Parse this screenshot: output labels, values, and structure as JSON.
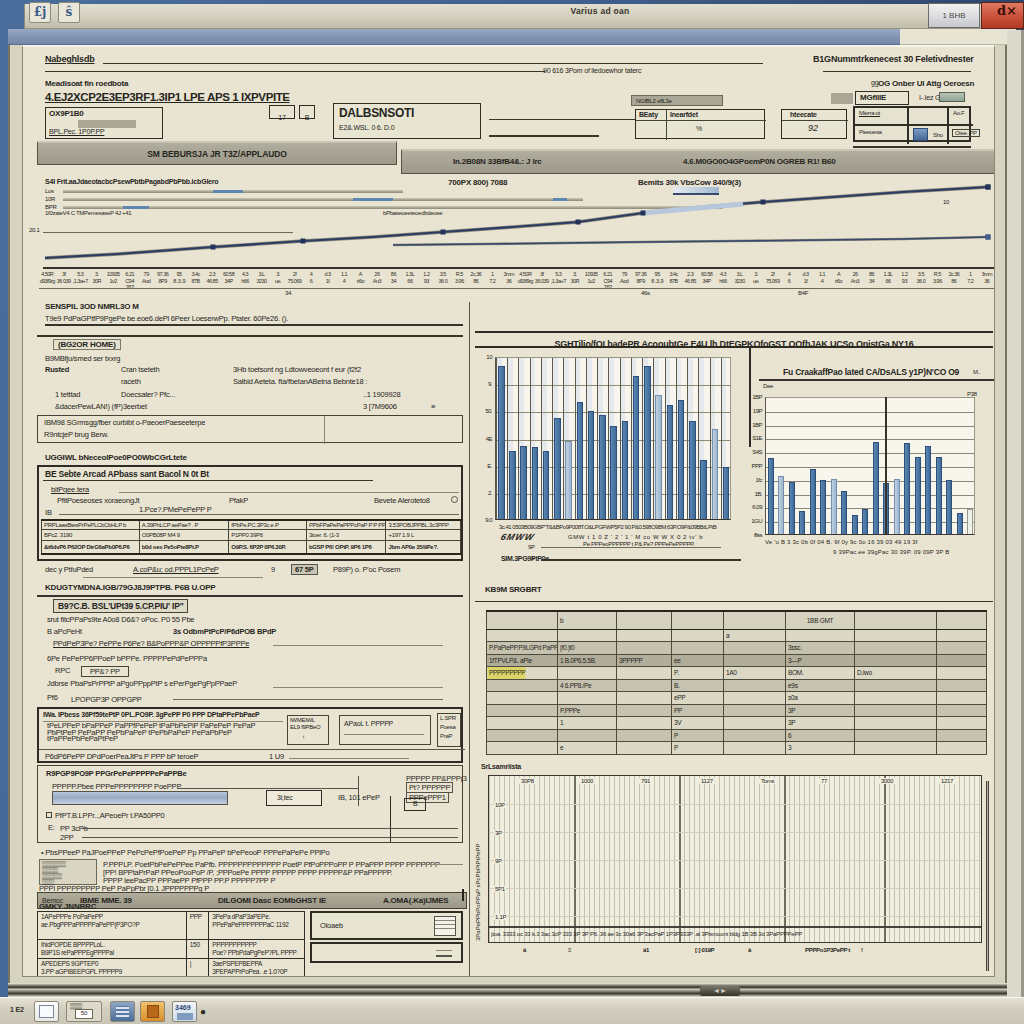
{
  "window": {
    "title": "Varius ad oan",
    "restore_button": "1 BHB",
    "close_button": "d×",
    "app_icon_1": "£j",
    "app_icon_2": "ŝ"
  },
  "header": {
    "left_label": "Nabeghlsdb",
    "right_label": "B1GNummtrkenecest 30 Feletivdnester",
    "center_note": "90 616 3Pom of liedoewhor taterc",
    "sub_label": "Meadisoat fin roedbota",
    "doc_title": "4.EJ2XCP2E3EP3RF1.3IP1 LPE APS 1 IXPVPITE",
    "field1_label": "OX9P1B0",
    "field1_value": "BPL.Pec. 1P0P.PP",
    "tick1": "17",
    "tick2": "B",
    "field2_label": "DALBSNSOTI",
    "field2_value": "E2&.WSL. 0 6. D.0",
    "dd_label": "NGfBL2 effL3e",
    "grid1_h1": "BEaty",
    "grid1_h2": "Inearfdet",
    "grid1_v": "%",
    "grid2_h": "hteecate",
    "grid2_v": "92",
    "right_top": "OG Onber UI  Attg Oeroesn",
    "right_gg": "gg",
    "right_chip": "MGfllIE",
    "right_small": "I-.Iez Gezet 9",
    "rg_r1c1": "Mierra ot",
    "rg_r1c3": "Ao.F",
    "rg_r2c1": "Pieeoesa",
    "rg_r2c3": "Oiee. PP",
    "rg_sho": "Sho"
  },
  "tabs": {
    "tab1": "SM BEBURSJA JR T3Z/APPLAUDO",
    "tab2": "In.2B08N 33BfB4&.: J lrc",
    "tab3": "4.6.M0GO0O4GPoemP0N OGREB R1!   B60"
  },
  "line_chart": {
    "title_left": "700PX 800)  7088",
    "title_right": "Bemits 30k VbsCow  840/9(3)",
    "legend_caption": "S4I Frit.aaJdaeotacbcPsewPbtbPagabdPbPbb.icbGlero",
    "legend_rows": [
      "Los",
      "10R",
      "BPR"
    ],
    "legend_note1": "1f0zateV4 C TMPemesaseP  4J    +41",
    "legend_note2": "bPbaseoeeteoedbdeoee",
    "ytick": "20.1",
    "callout": "10",
    "series_a": [
      [
        2,
        9
      ],
      [
        75,
        13
      ],
      [
        170,
        20
      ],
      [
        260,
        26
      ],
      [
        330,
        30
      ],
      [
        400,
        35
      ],
      [
        470,
        40
      ],
      [
        535,
        45
      ],
      [
        600,
        54
      ],
      [
        660,
        60
      ],
      [
        720,
        65
      ],
      [
        790,
        70
      ],
      [
        860,
        75
      ],
      [
        945,
        80
      ]
    ],
    "series_b": [
      [
        350,
        22
      ],
      [
        440,
        23
      ],
      [
        520,
        24
      ],
      [
        600,
        25
      ],
      [
        690,
        26
      ],
      [
        780,
        27
      ],
      [
        860,
        28
      ],
      [
        945,
        30
      ]
    ],
    "markers_a": [
      2,
      3,
      5,
      7,
      8,
      10,
      13
    ],
    "markers_b": [
      7
    ]
  },
  "strip": {
    "row1": [
      "4.50R",
      "3f",
      "5.3",
      "3.",
      "10935",
      "6.21",
      "79",
      "97.36",
      "95",
      "3.4c",
      "2.3",
      "60.58",
      "4.3",
      "3.L",
      "3.",
      "2f",
      "4",
      "d.3",
      "1.1",
      "A",
      "26",
      "86",
      "1.3L",
      "1.2",
      "3.5",
      "R.5",
      "2c.36",
      "1",
      "3mm"
    ],
    "row2": [
      "d93f9rg",
      "36 039",
      ",1.3a+7",
      "30R",
      "1v2",
      "C94 76?",
      "Aod",
      "8P9",
      "8 .3..9",
      "87B",
      "46 85",
      "34P",
      "h66",
      "3230",
      "ue.",
      "75.069",
      "6",
      "1f",
      "4",
      "ri6o",
      "An3",
      "34",
      "66",
      "93",
      "36 0",
      "3.96",
      "86",
      "7.2",
      "36"
    ],
    "label1": "34.",
    "label2": "46s",
    "label3": "B4F"
  },
  "left": {
    "h1": "SENSPIL 3OD NMRL3O M",
    "p1": "T9e9 PdPaGPtfP9PgePe be.eoe6.dePl 6Peer LoeserwPp. Ptater. 60Pe26. ().",
    "tag": "(BG2OR HOME)",
    "s1": "B9MBfju/smed ser txxrg",
    "r1a": "Rusted",
    "r1b": "Cran tseteth",
    "r1c": "3Hb toetsont ng Ldtowveoeont f eur (f2f2",
    "r2b": "raceth",
    "r2c": "Salbid Aeteta. fta/fbetanABetna Bebnte18 :",
    "r3a": "1 tetttad",
    "r3b": "Doecsater? Pfc...",
    "r3c": "..1 1909928",
    "r4a": "&dacerPewLAN!) (fP)3eerbet",
    "r4b": "3 [7M9606",
    "r4c": "≡",
    "box1_l1": "IBM98 SGrmsgg/fber curbibt o-PaeoerPaeseeterpe",
    "box1_l2": "R9ntcjeP brug Berw.",
    "h2": "UGGIWL bNeceoIPoe0PO0WbCGrLtete",
    "bx_title": "BE Sebte Arcad APbass sant Bacol N 0t Bt",
    "bx_lab": "bitPgee.tera",
    "bx_r1": "PfitPoeseoses xoraeongJt",
    "bx_r2": "PfakP",
    "bx_r3": "Bevete Aleroteto8",
    "bx_ib": "IB",
    "bx_note": "1.Pce?.PMePePePP  P",
    "tbl_h": [
      "PRPLaasBtesPrPePLCbCbHLP b",
      "A.39PhLCP aePae?  . P",
      "fPbPe.PC.3P3c.e P",
      "PPbFPaPePaPPPcPaP P P PPePP",
      "3.53POBJPPBL.3c3PPP"
    ],
    "tbl_r1": [
      "BPc2.        3190",
      "O0PB08P      M4 9",
      "P1PP0        39P6",
      "3toer.    6. (1-3",
      "+197 1.9 L"
    ],
    "tbl_r2": [
      "&t6dvP6 P62OP DtrG6aPb0P6.P6",
      "b0d oes Pe5oPte8Pt.P",
      "O9P.S. 6P2P 0P6.30P.",
      "bGSP P6! OPtP. 9P6 1P6",
      "Jbm AP0e 35/9Pe?."
    ],
    "under1": "dec y PtfuPded",
    "under2": "A.coP&u; od.PPPL1PcPeP",
    "under3": "9",
    "under4": "67 5P",
    "under5": "P89P) o. P'oc Posem",
    "h3": "KDUGTYMDNA.IGB/79GJ8J9PTPB. P6B U.OPP",
    "s3_t1": "B9?C.B. BSL'UPt39 5.CP.PIU' IP\"",
    "s3_l1": "srut fitcPPaPs9te A0o8 D6&? oPoc. P0 55 Pbe",
    "s3_l2": "B aPcPeHt",
    "s3_l3": "3s OdbmPtPcP/P6dPOB BPdP",
    "s3_l4": "PPdPeP3Pe? PePPe P6Pe? B&PoPPP&P OPPPPPfP3PPPe",
    "s3_l5": "6Pe PePePP6PPoeP bPPPe. PPPPPePdPePPPa",
    "s3_l6": "RPC",
    "s3_l6b": "PP&? PP",
    "s3_l7": "Jdbrse PbaPsPrPPtP aPgoPPppPtP s ePerPgePgPpPPaeP",
    "s3_l8": "Pf6",
    "s3_l8b": "LPOPGP3P OPPGPP",
    "cx_t1": "IWa. IPbess 36Pf59tePtP 0PL.PO9P. 3gPePP P0 PPP DPtaPPePbPaeP",
    "cx_dense": "tPeLPPeP bPaPPeP PaPPfPePeP tPaPbPePiP PaPePeP PePaP PbPtPeP PePaPP PePbPaPeP tPePbPaPeP PePaPbPeP tPaPPePbPePaPtPeP",
    "cx_b1a": "IWMEIWL",
    "cx_b1b": "EL9 f9PBeO",
    "cx_b2": "APaoL t. PPPPP",
    "cx_b3a": "L.SPR",
    "cx_b3b": "Poesa",
    "cx_b3c": "PraP",
    "cx_l2": "P6dP6PePP DPdPoerPeaJtPs P PPP bP teroeP",
    "cx_l2b": "1 U9",
    "c2_t1": "R9PGP9PO9P PPGrPePePPPPPePaPPBe",
    "c2_l1": "PPPPP.Pbee PPPePPPPPPPP PoePPP",
    "c2_r1": "PPPPP PP&PPP(3",
    "c2_r2": "Pt? PPPPPP",
    "c2_r3": "PPPePPP1",
    "c2_bx1": "3i,tec",
    "c2_bx2": "IB, 101 ePeP",
    "c2_bx3": "B",
    "c2_l3": "PfPT.B.LPPr..,APeoePr t.PA50PP0",
    "c2_e1": "E:",
    "c2_e2": "PP 3cPb",
    "c2_e3": "2PP",
    "bullet": "• PbsPPeeP PaJPoePPeP PePcPePfPoePeP Pp PPaPeP bPePeooP PPPePaPePe PPlPo",
    "n1": "P.PPPLP. PoetPbPePePPee PaPfb.  PPPPPPPPPPPPP PoetP PfPoPPPoPP P PPaPPP PPPP PPPPPPP",
    "n2": "[PP! BPPtaPrPaP PPeoPooPoP /P, ;PPPoePe PPPP PPPPP PPPP PPPPP&P PPaPPPPP.",
    "n3": "PPPP IeePacPP PPPaePP PfPPP PP.P PPPPP7PP P",
    "n4": "PPPl PPPPPPPPP PeP PaPpPbr [0.1 JPPPPPPPg P",
    "band1": "Bemoc",
    "band2": "IBME MME. 39",
    "band3": "DILGOMI Dasc EOMbGHST IE",
    "band4": "A.OMA(.Ka)IJMES",
    "bl_title": "GMKY JNNRRC",
    "bl_r1c1a": "1APePPPe PoPaPePP",
    "bl_r1c1b": "ae.PbgPPPaPPPPPaPePP(P3PO?P",
    "bl_r1c2": "PPP",
    "bl_r1c3a": "3PePa dPaP3aPEPe.",
    "bl_r1c3b": "PPePaPePPPPPPPaC",
    "bl_r1n": "1192",
    "bl_r1c4": "Oloaeb",
    "bl_r2c1a": "IhidPOPDE BPPPPLoL.",
    "bl_r2c1b": "B9P1S rePaPPPEgPPPPal",
    "bl_r2c2": "150",
    "bl_r2c3a": "PPPPPPPPPPP",
    "bl_r2c3b": "Poe? PPbPdaPgPeP?PL",
    "bl_r2n": "PPPP",
    "bl_r3c1a": "APEDEPS 9GPTEP0",
    "bl_r3c1b": "3.PP aGPIBEEPGPL PPPPP9",
    "bl_r3c2": "|",
    "bl_r3c3a": "3aePSPEPBEPPA",
    "bl_r3c3b": "3PEPAPPrPoPea. .e  1.0?0P"
  },
  "right": {
    "panel_title": "SGHTilio/fOI badePR AcooubtGe E4U lh DtEGPKOfoGST OOfhJAK UCSo OnistGa NY16",
    "chart1": {
      "type": "bar",
      "ylabels": [
        "10",
        "9.",
        "50.",
        "4E",
        "E.",
        "2.",
        "9.0"
      ],
      "values": [
        94,
        42,
        45,
        44,
        42,
        62,
        48,
        72,
        66,
        64,
        57,
        60,
        88,
        94,
        76,
        70,
        73,
        60,
        36,
        55,
        32
      ],
      "light_bars": [
        6,
        14,
        19
      ],
      "xrow1": "3c.41 0503B09GBP\"T&&BPo9P008T.O&LPGFWP5P2   90.P&0.598O9BM.63P.O9P&09BB&.PtB",
      "xrow2": "GMW  t  1  0  Z  '  2  '  1  '  M  co  W  W  X  0  2 tv'  b",
      "sig": "6MWW",
      "leg1": "9P",
      "leg1b": "Pe PPPeoPPPPPP  t  P&  Pe? PPPePePPPPP.",
      "leg2": "1",
      "foot": "SIM.3PG9PtP0e"
    },
    "chart2": {
      "type": "bar",
      "title": "Fu CraakaffPao lated CA/DsALS  y1P)N'CO O9",
      "title_tick": "M..",
      "dee": "Dee",
      "right_tick": "P38",
      "ylabels": [
        "1BP",
        "19P",
        "1BP",
        "S1E",
        "S4S",
        "PPP",
        "1fc",
        "1B.",
        "6.09",
        "1GU",
        "ffiss"
      ],
      "values": [
        55,
        42,
        38,
        17,
        47,
        39,
        40,
        31,
        14,
        18,
        67,
        37,
        40,
        66,
        56,
        64,
        56,
        39,
        15,
        18
      ],
      "light_bars": [
        1,
        6,
        12
      ],
      "ghost_bars": [
        19
      ],
      "xrow1": "Ve  'u  B  3  3c  0b  0f  04  B.  9f  0y  9c  0o  16  39  03  49  19  3f",
      "xrow2": "9  39Pac.ee 39gPac 30 39P. 09 09P   3P    B"
    },
    "summary_title": "KB9M SRGBRT",
    "table_rows": [
      {
        "style": "hdr",
        "cells": [
          "",
          "b",
          "",
          "",
          "",
          "1BB GMT",
          "",
          ""
        ]
      },
      {
        "style": "plain",
        "cells": [
          "",
          "",
          "",
          "",
          "a",
          "",
          "",
          ""
        ]
      },
      {
        "style": "mid",
        "cells": [
          "P.PaPiePP.P9LGPd PaPP",
          "|f0.)t0",
          "",
          "",
          "",
          "3ssc.",
          "",
          ""
        ]
      },
      {
        "style": "dark",
        "cells": [
          "1fTPVLP&. aPie",
          "1 B.0P6.5.5B",
          "3PPPPP",
          "ee",
          "",
          "3—P",
          "",
          ""
        ]
      },
      {
        "style": "plain",
        "cells": [
          "PPPPPPPPP",
          "",
          "",
          "P.",
          "1A0",
          "BOM.",
          "D.lwo",
          ""
        ]
      },
      {
        "style": "mid",
        "cells": [
          "",
          "4 6.PP8./Pe",
          "",
          "B.",
          "",
          "e9s",
          "",
          ""
        ]
      },
      {
        "style": "plain",
        "cells": [
          "",
          "",
          "",
          "ePP",
          "",
          "s0a",
          "",
          ""
        ]
      },
      {
        "style": "mid",
        "cells": [
          "",
          "P.PPPe",
          "",
          "PP",
          "",
          "3P",
          "",
          ""
        ]
      },
      {
        "style": "plain",
        "cells": [
          "",
          "1",
          "",
          "3V",
          "",
          "3P",
          "",
          ""
        ]
      },
      {
        "style": "mid",
        "cells": [
          "",
          "",
          "",
          "P",
          "",
          "6",
          "",
          ""
        ]
      },
      {
        "style": "plain",
        "cells": [
          "",
          "e",
          "",
          "P",
          "",
          "3",
          "",
          ""
        ]
      }
    ],
    "gantt_title": "SrLsamriista",
    "gantt": {
      "top_labels": [
        "30P8",
        "1000",
        "791",
        "1127",
        "Toms",
        "77",
        "3000",
        "1217"
      ],
      "left_labels": [
        "10P",
        "3P",
        "9P",
        "5P1",
        "1.1P"
      ],
      "side_text": "3PaPePPbPoPPaP sPcPbPtPtPePP",
      "side_text2": "1P",
      "bottom_text": "jtoa. 3333 oc 33 k.3 3ac.3cP 333 3P 3P P6. 36  ae 3c 30a6 3P'3acPaP 1P3P333P  .al 3Plsmoont bldg 1B 3B 3d  3PaPPPPePP",
      "bottom_marks": [
        "ä",
        "≡",
        "ä1",
        "[:] 019P",
        "ä",
        "PPPPo1P3PePP  t",
        "!"
      ],
      "baseline_note": "1PP. PoPc"
    },
    "notch": "◄►"
  },
  "taskbar": {
    "tray": "1 E2",
    "icons": [
      "page-icon",
      "folder-50-icon",
      "grid-blue-icon",
      "orange-app-icon",
      "blue-3469-icon"
    ],
    "icon3_text": "50",
    "icon6_text": "3469",
    "dot": "●"
  },
  "colors": {
    "desktop_blue": "#41618d",
    "window_cream": "#e9e4d1",
    "band_gray": "#a8a496",
    "bar_blue": "#4a76a4",
    "line_navy": "#2c3c64",
    "close_red": "#c14a33",
    "taskbar_gray": "#d2cec0",
    "highlight_yellow": "#ddd469"
  },
  "chart_data": [
    {
      "type": "line",
      "title": "Bemits 30k VbsCow 840/9(3)",
      "series": [
        {
          "name": "series-a-rising",
          "x": [
            0,
            75,
            170,
            260,
            330,
            400,
            470,
            535,
            600,
            660,
            720,
            790,
            860,
            945
          ],
          "y": [
            9,
            13,
            20,
            26,
            30,
            35,
            40,
            45,
            54,
            60,
            65,
            70,
            75,
            80
          ]
        },
        {
          "name": "series-b-flat",
          "x": [
            350,
            440,
            520,
            600,
            690,
            780,
            860,
            945
          ],
          "y": [
            22,
            23,
            24,
            25,
            26,
            27,
            28,
            30
          ]
        }
      ],
      "legend_position": "top-left",
      "grid": false
    },
    {
      "type": "bar",
      "title": "SGHTilio/fOI badePR AcooubtGe E4U lh DtEGPKOfoGST",
      "values": [
        94,
        42,
        45,
        44,
        42,
        62,
        48,
        72,
        66,
        64,
        57,
        60,
        88,
        94,
        76,
        70,
        73,
        60,
        36,
        55,
        32
      ],
      "ylim": [
        0,
        100
      ],
      "grid": true
    },
    {
      "type": "bar",
      "title": "Fu CraakaffPao lated CA/DsALS y1P)N'CO O9",
      "values": [
        55,
        42,
        38,
        17,
        47,
        39,
        40,
        31,
        14,
        18,
        67,
        37,
        40,
        66,
        56,
        64,
        56,
        39,
        15,
        18
      ],
      "ylim": [
        0,
        100
      ],
      "grid": true
    }
  ]
}
